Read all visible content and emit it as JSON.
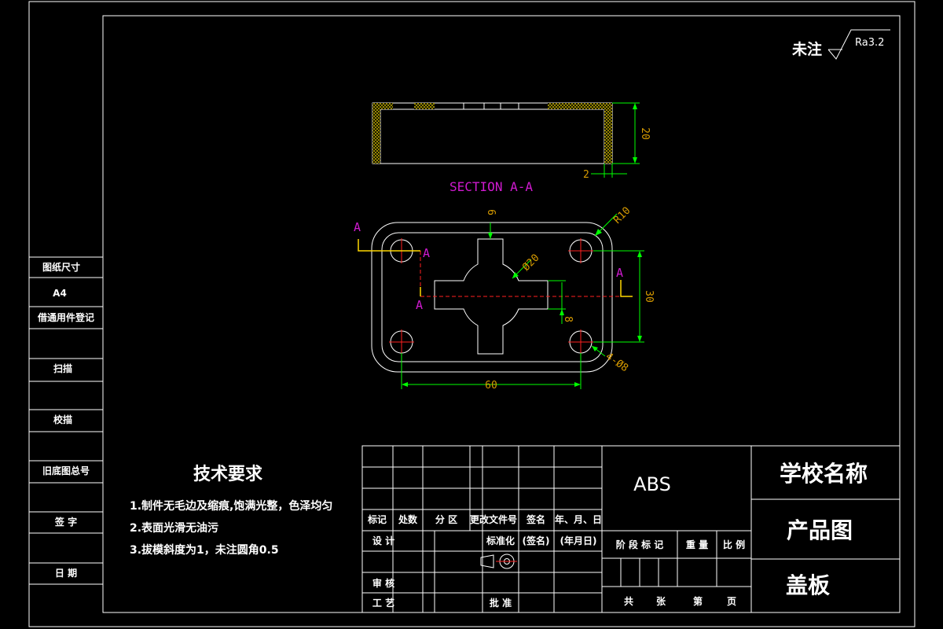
{
  "roughness": {
    "prefix": "未注",
    "value": "Ra3.2"
  },
  "section_title": "SECTION A-A",
  "section_marks": {
    "a1": "A",
    "a2": "A",
    "a3": "A",
    "a4": "A"
  },
  "dims": {
    "height": "20",
    "wall": "2",
    "rib_top": "6",
    "radius": "R10",
    "center_dia": "Ø20",
    "rib_width": "8",
    "hole_span_y": "30",
    "holes": "4-Ø8",
    "hole_span_x": "60"
  },
  "left_strip": [
    {
      "label": "图纸尺寸"
    },
    {
      "label": "A4"
    },
    {
      "label": "借通用件登记"
    },
    {
      "label": ""
    },
    {
      "label": "扫描"
    },
    {
      "label": ""
    },
    {
      "label": "校描"
    },
    {
      "label": ""
    },
    {
      "label": "旧底图总号"
    },
    {
      "label": ""
    },
    {
      "label": "签 字"
    },
    {
      "label": ""
    },
    {
      "label": "日 期"
    }
  ],
  "tech": {
    "title": "技术要求",
    "items": [
      "1.制件无毛边及缩痕,饱满光整，色泽均匀",
      "2.表面光滑无油污",
      "3.拔模斜度为1，未注圆角0.5"
    ]
  },
  "title_block": {
    "rev_headers": [
      "标记",
      "处数",
      "分 区",
      "更改文件号",
      "签名",
      "年、月、日"
    ],
    "row_design": {
      "label": "设 计",
      "std": "标准化",
      "sign": "(签名)",
      "date": "(年月日)"
    },
    "row_review": "审 核",
    "row_process": "工 艺",
    "approve": "批 准",
    "material": "ABS",
    "stage_headers": [
      "阶 段 标 记",
      "重 量",
      "比 例"
    ],
    "sheet_info": [
      "共",
      "张",
      "第",
      "页"
    ],
    "school": "学校名称",
    "drawing_type": "产品图",
    "part_name": "盖板"
  }
}
